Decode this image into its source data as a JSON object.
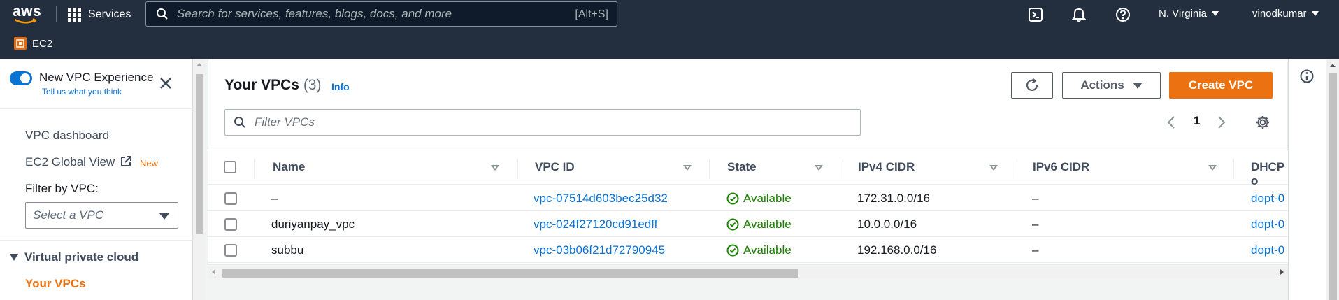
{
  "topbar": {
    "logo_text": "aws",
    "services_label": "Services",
    "search_placeholder": "Search for services, features, blogs, docs, and more",
    "search_shortcut": "[Alt+S]",
    "region": "N. Virginia",
    "user": "vinodkumar",
    "service_badge": "EC2",
    "icons": [
      "grid-icon",
      "search-icon",
      "cloudshell-icon",
      "bell-icon",
      "help-icon"
    ]
  },
  "sidebar": {
    "new_vpc_title": "New VPC Experience",
    "new_vpc_subtitle": "Tell us what you think",
    "links": [
      "VPC dashboard",
      "EC2 Global View"
    ],
    "new_tag": "New",
    "filter_label": "Filter by VPC:",
    "select_placeholder": "Select a VPC",
    "section_label": "Virtual private cloud",
    "active_item": "Your VPCs"
  },
  "main": {
    "title": "Your VPCs",
    "count": "(3)",
    "info_label": "Info",
    "actions_label": "Actions",
    "create_label": "Create VPC",
    "filter_placeholder": "Filter VPCs",
    "page_number": "1"
  },
  "table": {
    "columns": [
      "Name",
      "VPC ID",
      "State",
      "IPv4 CIDR",
      "IPv6 CIDR",
      "DHCP o"
    ],
    "rows": [
      {
        "name": "–",
        "vpc_id": "vpc-07514d603bec25d32",
        "state": "Available",
        "ipv4": "172.31.0.0/16",
        "ipv6": "–",
        "dhcp": "dopt-0"
      },
      {
        "name": "duriyanpay_vpc",
        "vpc_id": "vpc-024f27120cd91edff",
        "state": "Available",
        "ipv4": "10.0.0.0/16",
        "ipv6": "–",
        "dhcp": "dopt-0"
      },
      {
        "name": "subbu",
        "vpc_id": "vpc-03b06f21d72790945",
        "state": "Available",
        "ipv4": "192.168.0.0/16",
        "ipv6": "–",
        "dhcp": "dopt-0"
      }
    ]
  },
  "colors": {
    "accent": "#ec7211",
    "link": "#0972d3",
    "success": "#1d8102",
    "topbar": "#232f3e"
  }
}
